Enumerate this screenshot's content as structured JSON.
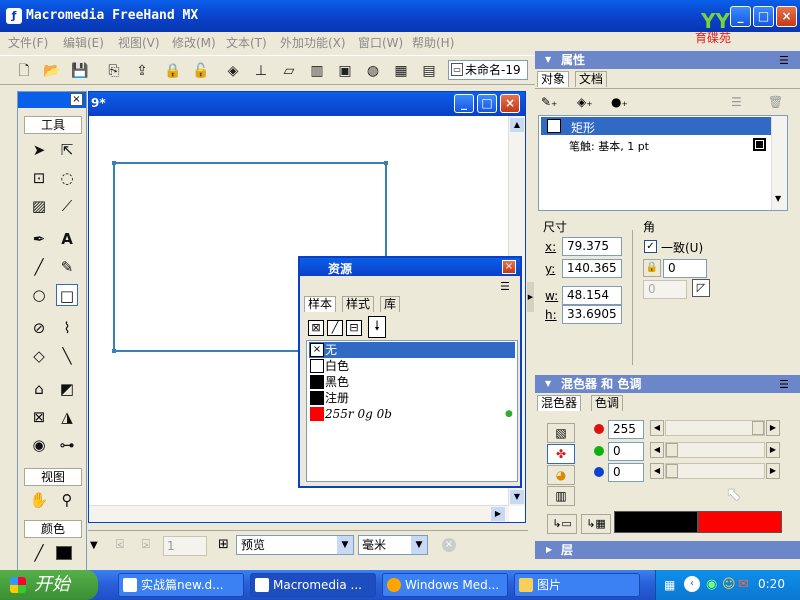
{
  "app": {
    "title": "Macromedia FreeHand MX",
    "logo_text": "育碟苑"
  },
  "menu": [
    "文件(F)",
    "编辑(E)",
    "视图(V)",
    "修改(M)",
    "文本(T)",
    "外加功能(X)",
    "窗口(W)",
    "帮助(H)"
  ],
  "toolbar": {
    "document_name": "未命名-19"
  },
  "document": {
    "title_fragment": "9*"
  },
  "tools_panel": {
    "section_tools": "工具",
    "section_view": "视图",
    "section_color": "颜色"
  },
  "status": {
    "view_mode": "预览",
    "units": "毫米",
    "page_value": "1"
  },
  "assets_panel": {
    "title": "资源",
    "tabs": [
      "样本",
      "样式",
      "库"
    ],
    "swatches": [
      {
        "name": "无",
        "color": "#ffffff",
        "selected": true
      },
      {
        "name": "白色",
        "color": "#ffffff"
      },
      {
        "name": "黑色",
        "color": "#000000"
      },
      {
        "name": "注册",
        "color": "#000000"
      },
      {
        "name": "255r 0g 0b",
        "color": "#ff0000"
      }
    ]
  },
  "properties_panel": {
    "title": "属性",
    "tabs": [
      "对象",
      "文档"
    ],
    "object_name": "矩形",
    "stroke_text": "笔触: 基本, 1 pt",
    "size_label": "尺寸",
    "corner_label": "角",
    "x_label": "x:",
    "y_label": "y:",
    "w_label": "w:",
    "h_label": "h:",
    "x": "79.375",
    "y": "140.365",
    "w": "48.154",
    "h": "33.6905",
    "uniform_label": "一致(U)",
    "corner_value": "0",
    "corner_value2": "0"
  },
  "mixer_panel": {
    "title": "混色器 和 色调",
    "tabs": [
      "混色器",
      "色调"
    ],
    "r": "255",
    "g": "0",
    "b": "0",
    "r_fraction": 1.0,
    "g_fraction": 0.0,
    "b_fraction": 0.0,
    "previous_color": "#000000",
    "current_color": "#ff0000"
  },
  "layers_panel": {
    "title": "层"
  },
  "taskbar": {
    "start_label": "开始",
    "tasks": [
      "实战篇new.d...",
      "Macromedia ...",
      "Windows Med...",
      "图片"
    ],
    "clock": "0:20"
  }
}
